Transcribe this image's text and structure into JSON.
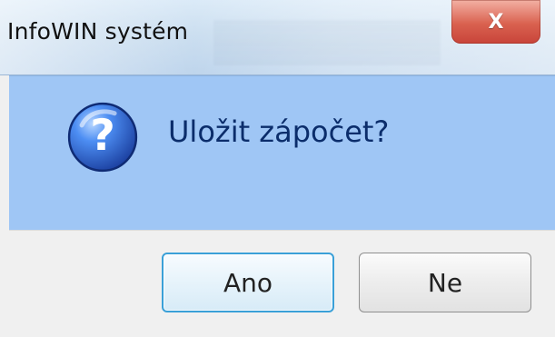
{
  "window": {
    "title": "InfoWIN systém"
  },
  "dialog": {
    "message": "Uložit zápočet?",
    "icon": "question-icon",
    "buttons": {
      "yes_label": "Ano",
      "no_label": "Ne"
    }
  },
  "colors": {
    "content_background": "#9fc6f5",
    "message_text": "#0b2d6b",
    "default_button_border": "#3aa0d8",
    "close_button_red": "#d9614f"
  },
  "titlebar_controls": {
    "close_glyph": "X"
  }
}
